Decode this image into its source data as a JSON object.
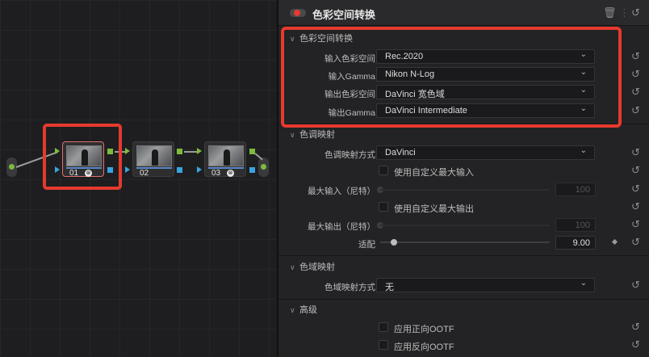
{
  "inspector": {
    "title": "色彩空间转换",
    "trash_icon": "trash-icon",
    "reset_icon": "reset-icon"
  },
  "node_editor": {
    "nodes": [
      {
        "label": "01",
        "has_fx": true,
        "selected": true
      },
      {
        "label": "02",
        "has_fx": false,
        "selected": false
      },
      {
        "label": "03",
        "has_fx": true,
        "selected": false
      }
    ],
    "fx_glyph": "⊗"
  },
  "color_space_transform": {
    "section_label": "色彩空间转换",
    "input_color_space_label": "输入色彩空间",
    "input_color_space_value": "Rec.2020",
    "input_gamma_label": "输入Gamma",
    "input_gamma_value": "Nikon N-Log",
    "output_color_space_label": "输出色彩空间",
    "output_color_space_value": "DaVinci 宽色域",
    "output_gamma_label": "输出Gamma",
    "output_gamma_value": "DaVinci Intermediate"
  },
  "tone_mapping": {
    "section_label": "色调映射",
    "method_label": "色调映射方式",
    "method_value": "DaVinci",
    "custom_max_input_label": "使用自定义最大输入",
    "max_input_label": "最大输入（尼特）",
    "max_input_value": "100",
    "custom_max_output_label": "使用自定义最大输出",
    "max_output_label": "最大输出（尼特）",
    "max_output_value": "100",
    "adapt_label": "适配",
    "adapt_value": "9.00"
  },
  "gamut_mapping": {
    "section_label": "色域映射",
    "method_label": "色域映射方式",
    "method_value": "无"
  },
  "advanced": {
    "section_label": "高级",
    "forward_ootf_label": "应用正向OOTF",
    "inverse_ootf_label": "应用反向OOTF"
  },
  "colors": {
    "accent_red": "#e53a2e",
    "port_green": "#7dbb3c",
    "port_blue": "#3aa3e0"
  }
}
